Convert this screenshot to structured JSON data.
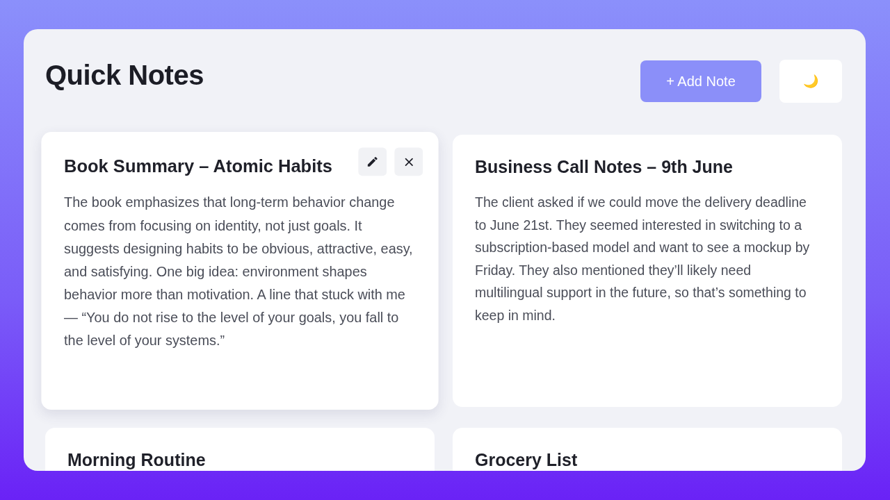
{
  "header": {
    "title": "Quick Notes",
    "add_button": "+ Add Note",
    "theme_button": "🌙"
  },
  "notes": [
    {
      "title": "Book Summary – Atomic Habits",
      "body": "The book emphasizes that long-term behavior change comes from focusing on identity, not just goals. It suggests designing habits to be obvious, attractive, easy, and satisfying. One big idea: environment shapes behavior more than motivation. A line that stuck with me — “You do not rise to the level of your goals, you fall to the level of your systems.”",
      "hovered": true
    },
    {
      "title": "Business Call Notes – 9th June",
      "body": "The client asked if we could move the delivery deadline to June 21st. They seemed interested in switching to a subscription-based model and want to see a mockup by Friday. They also mentioned they’ll likely need multilingual support in the future, so that’s something to keep in mind.",
      "hovered": false
    },
    {
      "title": "Morning Routine",
      "hovered": false
    },
    {
      "title": "Grocery List",
      "hovered": false
    }
  ]
}
